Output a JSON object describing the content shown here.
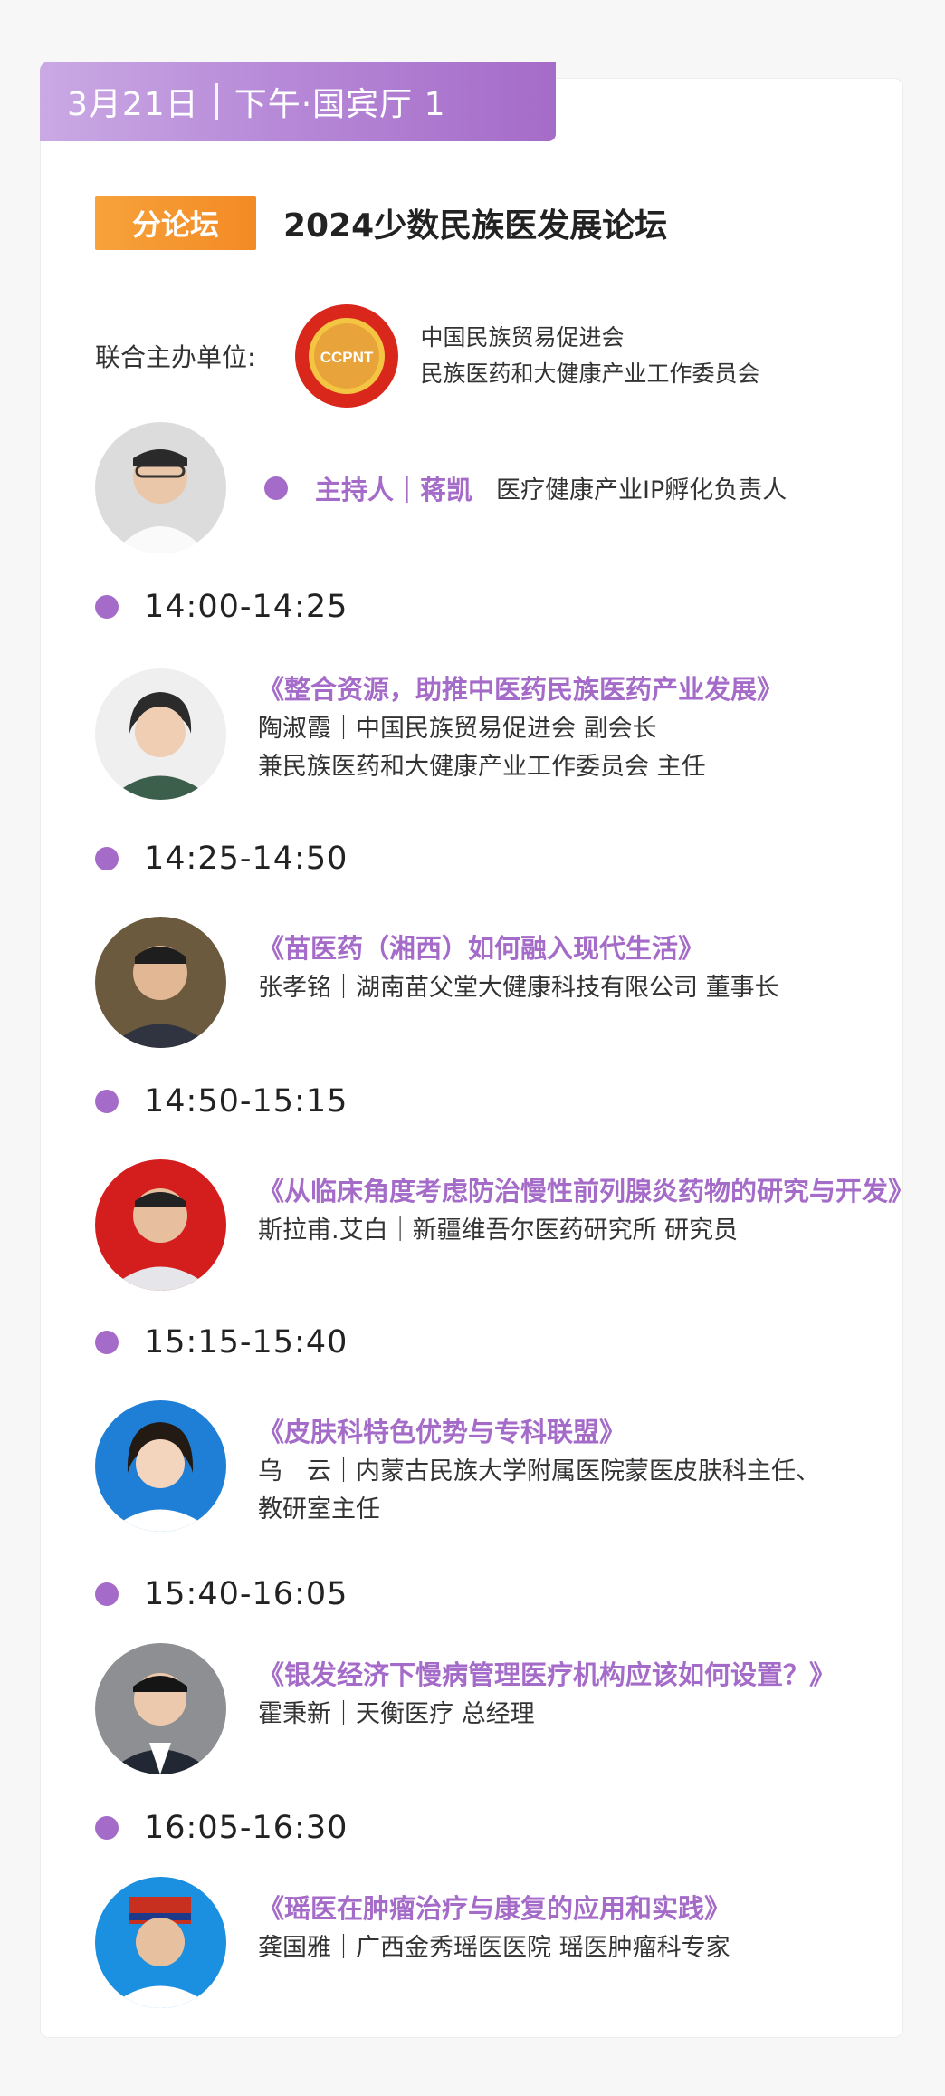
{
  "header": {
    "date": "3月21日",
    "session": "下午·国宾厅 1"
  },
  "forum": {
    "tag": "分论坛",
    "title": "2024少数民族医发展论坛"
  },
  "organizer": {
    "label": "联合主办单位:",
    "logo_text": "CCPNT",
    "logo_ring_text": "中国民族贸易促进会",
    "lines": [
      "中国民族贸易促进会",
      "民族医药和大健康产业工作委员会"
    ]
  },
  "host": {
    "role": "主持人｜蒋凯",
    "desc": "医疗健康产业IP孵化负责人"
  },
  "colors": {
    "accent": "#a56bc8",
    "tag_orange": "#f38a24"
  },
  "sessions": [
    {
      "time": "14:00-14:25",
      "title": "《整合资源，助推中医药民族医药产业发展》",
      "speaker": [
        "陶淑霞｜中国民族贸易促进会 副会长",
        "兼民族医药和大健康产业工作委员会 主任"
      ]
    },
    {
      "time": "14:25-14:50",
      "title": "《苗医药（湘西）如何融入现代生活》",
      "speaker": [
        "张孝铭｜湖南苗父堂大健康科技有限公司 董事长"
      ]
    },
    {
      "time": "14:50-15:15",
      "title": "《从临床角度考虑防治慢性前列腺炎药物的研究与开发》",
      "speaker": [
        "斯拉甫.艾白｜新疆维吾尔医药研究所 研究员"
      ]
    },
    {
      "time": "15:15-15:40",
      "title": "《皮肤科特色优势与专科联盟》",
      "speaker": [
        "乌　云｜内蒙古民族大学附属医院蒙医皮肤科主任、",
        "教研室主任"
      ]
    },
    {
      "time": "15:40-16:05",
      "title": "《银发经济下慢病管理医疗机构应该如何设置？》",
      "speaker": [
        "霍秉新｜天衡医疗 总经理"
      ]
    },
    {
      "time": "16:05-16:30",
      "title": "《瑶医在肿瘤治疗与康复的应用和实践》",
      "speaker": [
        "龚国雅｜广西金秀瑶医医院 瑶医肿瘤科专家"
      ]
    }
  ]
}
